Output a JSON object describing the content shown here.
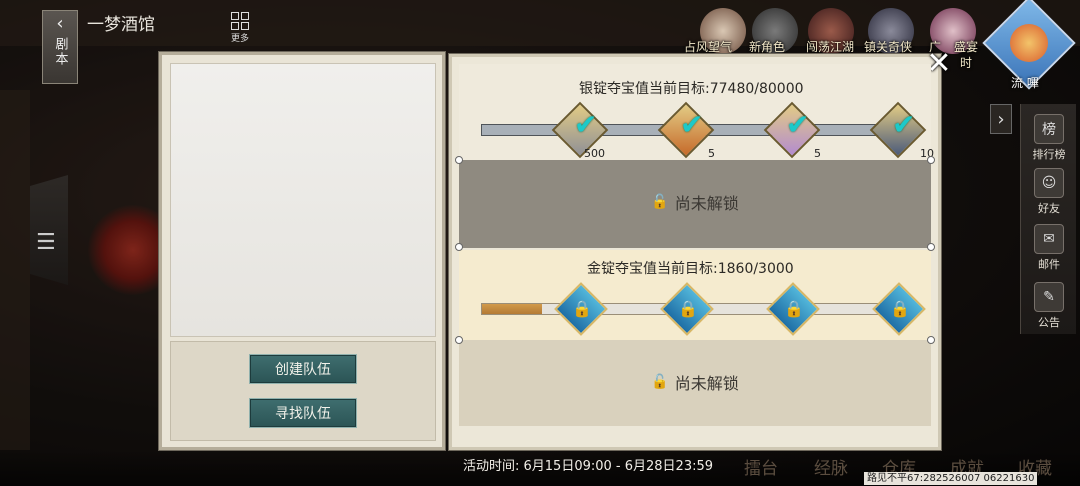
{
  "header": {
    "script_tab_label": "剧本",
    "location_title": "一梦酒馆",
    "more_label": "更多"
  },
  "events": [
    {
      "label": "占风望气"
    },
    {
      "label": "新角色"
    },
    {
      "label": "闯荡江湖"
    },
    {
      "label": "镇关奇侠"
    },
    {
      "label": "广"
    },
    {
      "label": "盛宴"
    },
    {
      "label": "时"
    }
  ],
  "liu_sheng_label": "流 嗶",
  "side_menu": [
    {
      "label": "排行榜",
      "icon": "ranking-icon"
    },
    {
      "label": "好友",
      "icon": "friends-icon"
    },
    {
      "label": "邮件",
      "icon": "mail-icon"
    },
    {
      "label": "公告",
      "icon": "announcement-icon"
    }
  ],
  "left_panel": {
    "create_team": "创建队伍",
    "find_team": "寻找队伍"
  },
  "silver": {
    "title": "银锭夺宝值当前目标:77480/80000",
    "current": 77480,
    "target": 80000,
    "rewards": [
      {
        "qty": "500",
        "claimed": true,
        "color": "#8f9096"
      },
      {
        "qty": "5",
        "claimed": true,
        "color": "#c66a2a"
      },
      {
        "qty": "5",
        "claimed": true,
        "color": "#b38bd0"
      },
      {
        "qty": "10",
        "claimed": true,
        "color": "#4a5a7a"
      }
    ],
    "locked_text": "尚未解锁"
  },
  "gold": {
    "title": "金锭夺宝值当前目标:1860/3000",
    "current": 1860,
    "target": 3000,
    "rewards": [
      {
        "locked": true
      },
      {
        "locked": true
      },
      {
        "locked": true
      },
      {
        "locked": true
      }
    ],
    "locked_text": "尚未解锁"
  },
  "footer": {
    "activity_time": "活动时间: 6月15日09:00 - 6月28日23:59",
    "nav": [
      "擂台",
      "经脉",
      "仓库",
      "成就",
      "收藏"
    ],
    "corner": "路见不平67:282526007 06221630"
  },
  "colors": {
    "teal_button": "#3f6e6f",
    "silver_fill": "#a8b0b8",
    "gold_fill": "#b47a34",
    "check": "#1cc9c9"
  }
}
